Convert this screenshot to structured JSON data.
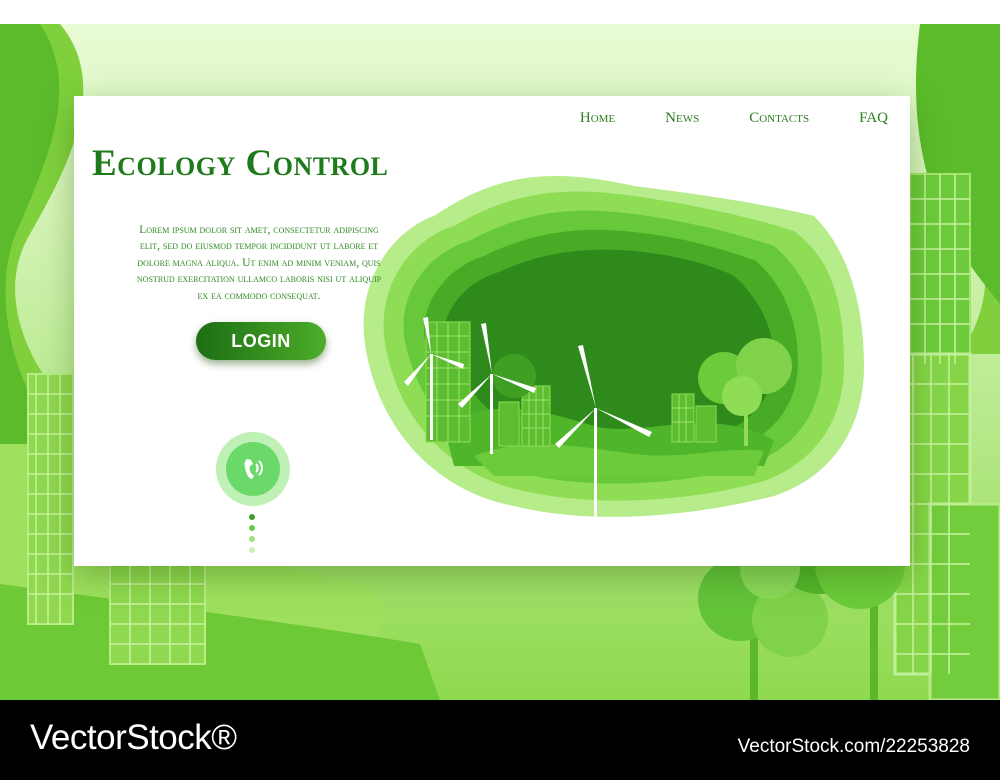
{
  "nav": {
    "items": [
      "Home",
      "News",
      "Contacts",
      "FAQ"
    ]
  },
  "hero": {
    "title": "Ecology Control",
    "body": "Lorem ipsum dolor sit amet, consectetur adipiscing elit, sed do eiusmod tempor incididunt ut labore et dolore magna aliqua. Ut enim ad minim veniam, quis nostrud exercitation ullamco laboris nisi ut aliquip ex ea commodo consequat.",
    "login_label": "LOGIN"
  },
  "phone": {
    "icon": "phone-icon"
  },
  "watermark": {
    "brand": "VectorStock®",
    "id": "VectorStock.com/22253828"
  },
  "colors": {
    "primary": "#1e7a1a",
    "accent": "#4cad2a",
    "light": "#bff0b6",
    "footer": "#000000"
  }
}
